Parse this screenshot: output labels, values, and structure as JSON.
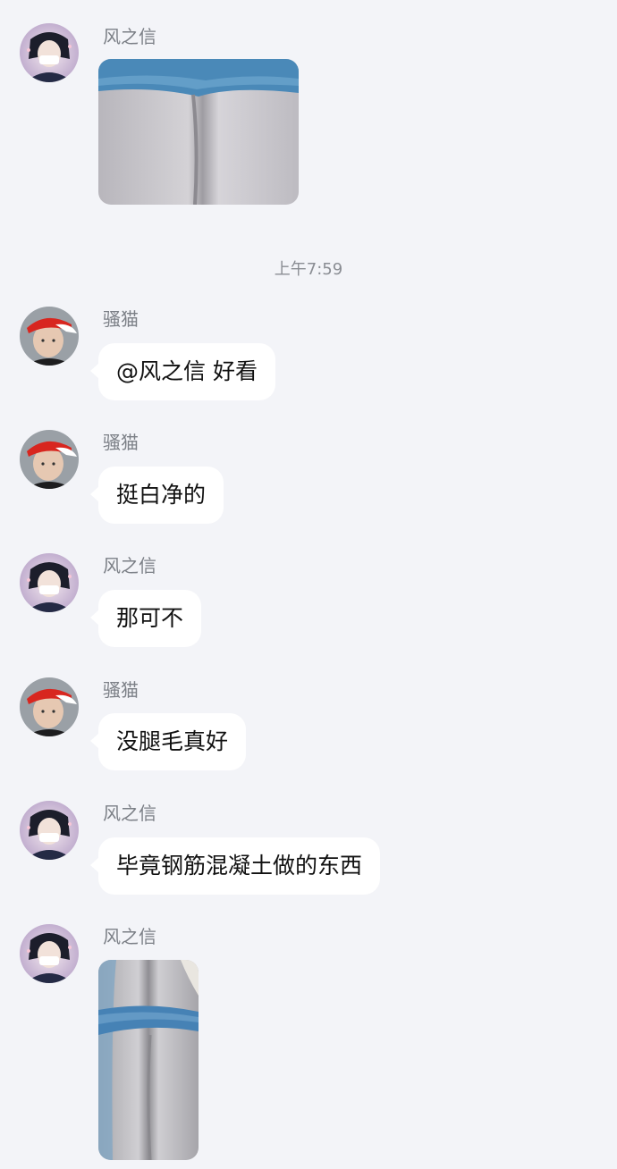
{
  "chat": {
    "timestamp": "上午7:59",
    "messages": [
      {
        "sender": "风之信",
        "type": "image"
      },
      {
        "sender": "骚猫",
        "type": "text",
        "text": "@风之信 好看"
      },
      {
        "sender": "骚猫",
        "type": "text",
        "text": "挺白净的"
      },
      {
        "sender": "风之信",
        "type": "text",
        "text": "那可不"
      },
      {
        "sender": "骚猫",
        "type": "text",
        "text": "没腿毛真好"
      },
      {
        "sender": "风之信",
        "type": "text",
        "text": "毕竟钢筋混凝土做的东西"
      },
      {
        "sender": "风之信",
        "type": "image"
      }
    ]
  },
  "colors": {
    "background": "#f3f4f8",
    "bubble": "#ffffff",
    "sender_name": "#7b7f86"
  }
}
